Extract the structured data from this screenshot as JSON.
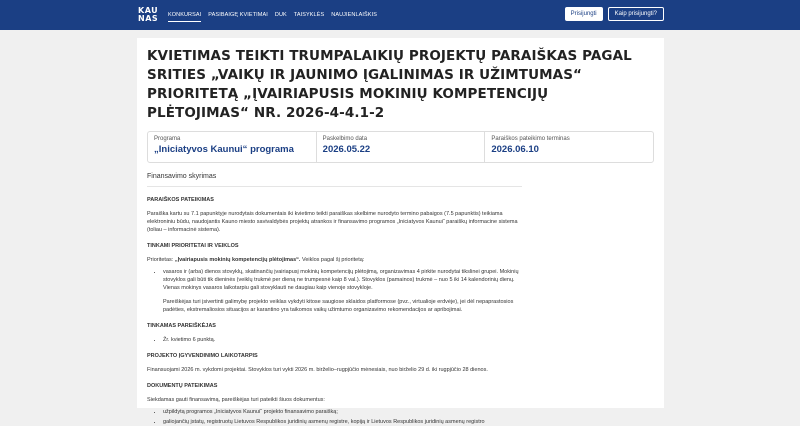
{
  "header": {
    "logo_line1": "KAU",
    "logo_line2": "NAS",
    "nav": [
      "KONKURSAI",
      "PASIBAIGĘ KVIETIMAI",
      "DUK",
      "TAISYKLĖS",
      "NAUJIENLAIŠKIS"
    ],
    "login_label": "Prisijungti",
    "how_login_label": "Kaip prisijungti?"
  },
  "call": {
    "title": "KVIETIMAS TEIKTI TRUMPALAIKIŲ PROJEKTŲ PARAIŠKAS PAGAL SRITIES „VAIKŲ IR JAUNIMO ĮGALINIMAS IR UŽIMTUMAS“ PRIORITETĄ „ĮVAIRIAPUSIS MOKINIŲ KOMPETENCIJŲ PLĖTOJIMAS“ NR. 2026-4-4.1-2",
    "program_label": "Programa",
    "program_value": "„Iniciatyvos Kaunui“ programa",
    "published_label": "Paskelbimo data",
    "published_value": "2026.05.22",
    "deadline_label": "Paraiškos pateikimo terminas",
    "deadline_value": "2026.06.10",
    "tab_label": "Finansavimo skyrimas"
  },
  "content": {
    "h1": "PARAIŠKOS PATEIKIMAS",
    "p1": "Paraiška kartu su 7.1 papunktyje nurodytais dokumentais iki kvietimo teikti paraiškas skelbime nurodyto termino pabaigos (7.5 papunktis) teikiama elektroniniu būdu, naudojantis Kauno miesto savivaldybės projektų atrankos ir finansavimo programos „Iniciatyvos Kaunui“ paraiškų informacine sistema (toliau – informacinė sistema).",
    "h2": "TINKAMI PRIORITETAI IR VEIKLOS",
    "p2_prefix": "Prioritetas: ",
    "p2_bold": "„Įvairiapusis mokinių kompetencijų plėtojimas“.",
    "p2_suffix": " Veiklos pagal šį prioritetą:",
    "li1": "vasaros ir (arba) dienos stovyklų, skatinančių įvairiapusį mokinių kompetencijų plėtojimą, organizavimas 4 pirkite nurodytai tikslinei grupei. Mokinių stovyklos gali būti tik dieninės (veiklų trukmė per dieną ne trumpesnė kaip 8 val.). Stovyklos (pamainos) trukmė – nuo 5 iki 14 kalendorinių dienų. Vienas mokinys vasaros laikotarpiu gali stovyklauti ne daugiau kaip vienoje stovykloje.",
    "p3": "Pareiškėjas turi įsivertinti galimybę projekto veiklas vykdyti kitose saugiose sklaidos platformose (pvz., virtualioje erdvėje), jei dėl nepaprastosios padėties, ekstremaliosios situacijos ar karantino yra taikomos vaikų užimtumo organizavimo rekomendacijos ar apribojimai.",
    "h3": "TINKAMAS PAREIŠKĖJAS",
    "li2": "Žr. kvietimo 6 punktą.",
    "h4": "PROJEKTO ĮGYVENDINIMO LAIKOTARPIS",
    "p4": "Finansuojami 2026 m. vykdomi projektai. Stovyklos turi vykti 2026 m. birželio–rugpjūčio mėnesiais, nuo birželio 29 d. iki rugpjūčio 28 dienos.",
    "h5": "DOKUMENTŲ PATEIKIMAS",
    "p5": "Siekdamas gauti finansavimą, pareiškėjas turi pateikti šiuos dokumentus:",
    "li3": "užpildytą programos „Iniciatyvos Kaunui“ projekto finansavimo paraišką;",
    "li4": "galiojančių įstatų, registruotų Lietuvos Respublikos juridinių asmenų registre, kopiją ir Lietuvos Respublikos juridinių asmenų registro"
  }
}
